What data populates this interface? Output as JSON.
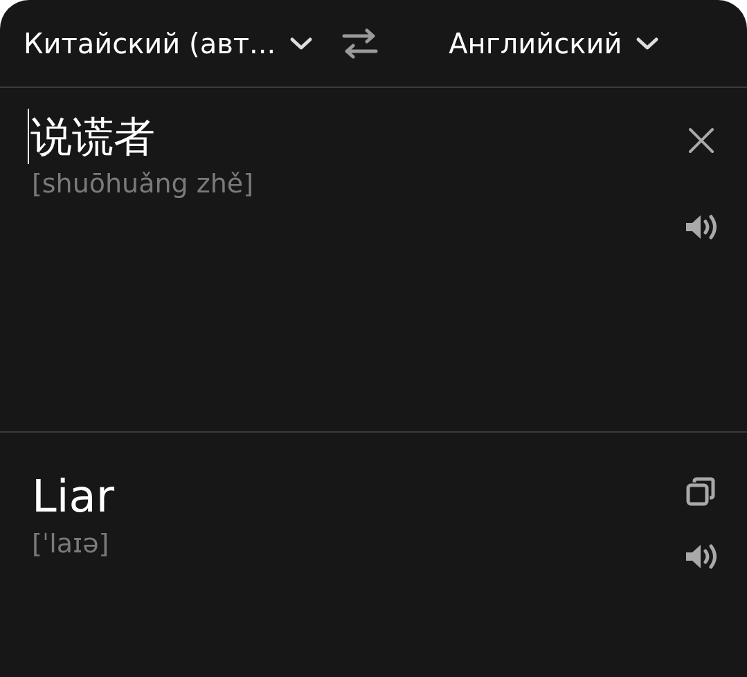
{
  "languages": {
    "source": "Китайский (авт...",
    "target": "Английский"
  },
  "source": {
    "text": "说谎者",
    "transliteration": "[shuōhuǎng zhě]"
  },
  "translation": {
    "text": "Liar",
    "transcription": "[ˈlaɪə]"
  }
}
